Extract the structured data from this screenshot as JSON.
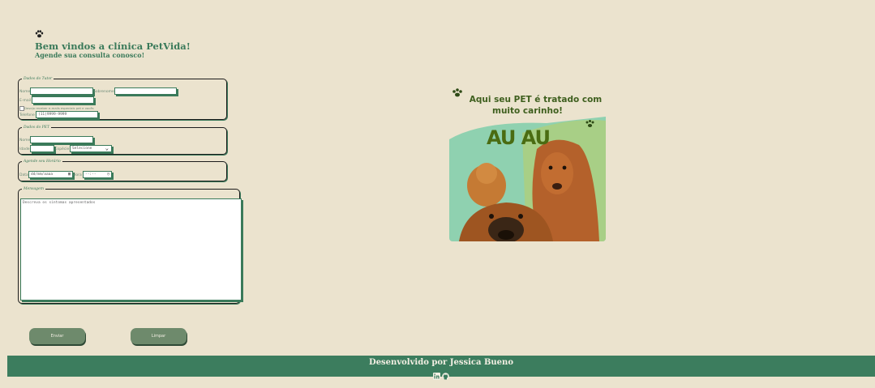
{
  "header": {
    "paw_icon": "paw-icon",
    "title": "Bem vindos a clínica PetVida!",
    "subtitle": "Agende sua consulta conosco!"
  },
  "tutor": {
    "legend": "Dados do Tutor",
    "name_label": "Nome",
    "surname_label": "Sobrenome",
    "email_label": "E-mail",
    "consent_label": "Desejo receber e-mails especiais pet e vocês",
    "phone_label": "Telefone",
    "phone_placeholder": "(11)9999-9999"
  },
  "pet": {
    "legend": "Dados do PET",
    "name_label": "Nome",
    "age_label": "Idade",
    "species_label": "Espécie",
    "species_value": "Selecione"
  },
  "schedule": {
    "legend": "Agende seu Horário",
    "date_label": "Data",
    "date_value": "dd/mm/aaaa",
    "time_label": "Hora",
    "time_value": "--:--"
  },
  "message": {
    "legend": "Mensagem",
    "placeholder": "Descreva os sintomas apresentados"
  },
  "buttons": {
    "send": "Enviar",
    "clear": "Limpar"
  },
  "promo": {
    "line1": "Aqui seu PET é tratado com",
    "line2": "muito carinho!",
    "big": "AU AU"
  },
  "footer": {
    "text": "Desenvolvido por Jessica Bueno",
    "icons": [
      "linkedin-icon",
      "github-icon"
    ]
  },
  "colors": {
    "background": "#ebe3ce",
    "accent": "#3c7d5e",
    "button": "#6e8a6c"
  }
}
